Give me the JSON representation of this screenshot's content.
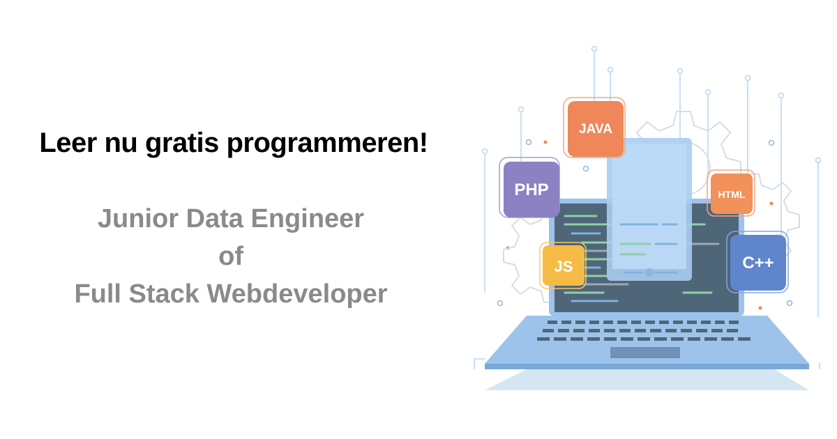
{
  "headline": "Leer nu gratis programmeren!",
  "subtitle": {
    "line1": "Junior Data Engineer",
    "line2": "of",
    "line3": "Full Stack Webdeveloper"
  },
  "illustration": {
    "badges": {
      "java": "JAVA",
      "php": "PHP",
      "html": "HTML",
      "js": "JS",
      "cpp": "C++"
    }
  },
  "colors": {
    "headline": "#000000",
    "subtitle": "#8a8a8a",
    "laptop_body": "#9dc3ea",
    "screen": "#4f6679",
    "java": "#f0875a",
    "php": "#8b82c4",
    "html": "#f2915a",
    "js": "#f5bb45",
    "cpp": "#5f86cc"
  }
}
